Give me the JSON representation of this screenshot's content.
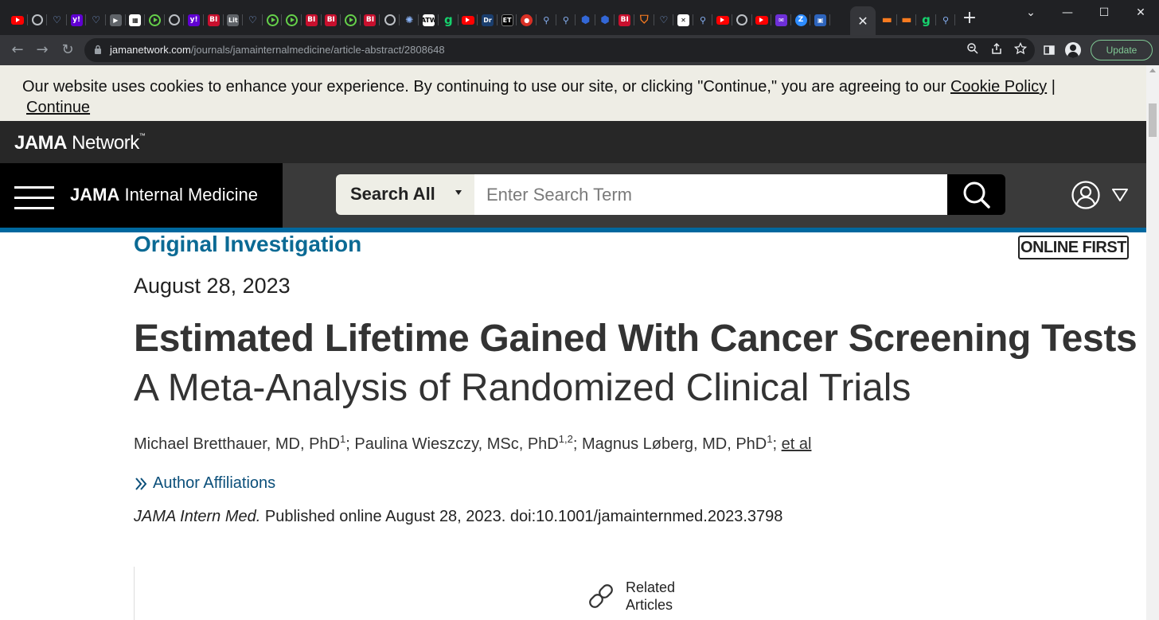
{
  "browser": {
    "active_tab_close": "✕",
    "new_tab": "+",
    "window": {
      "minimize": "⌄",
      "restore": "—",
      "maximize": "☐",
      "close": "✕"
    },
    "url_host": "jamanetwork.com",
    "url_path": "/journals/jamainternalmedicine/article-abstract/2808648",
    "update_label": "Update",
    "tab_favicons": [
      "youtube",
      "globe",
      "heart",
      "yahoo",
      "heart",
      "play-arrow",
      "grid",
      "play",
      "globe",
      "yahoo",
      "business-insider",
      "lit",
      "heart",
      "play",
      "play",
      "business-insider",
      "business-insider",
      "play",
      "business-insider",
      "globe",
      "burst",
      "fortune",
      "gizmodo",
      "youtube",
      "dr",
      "et",
      "mic",
      "search",
      "search",
      "hex",
      "hex",
      "business-insider",
      "shield",
      "heart",
      "academic",
      "search",
      "youtube",
      "globe",
      "youtube",
      "mail",
      "zoom",
      "portrait"
    ],
    "trailing_favicons": [
      "bookmark",
      "bookmark",
      "gizmodo",
      "search"
    ]
  },
  "cookie_banner": {
    "text": "Our website uses cookies to enhance your experience. By continuing to use our site, or clicking \"Continue,\" you are agreeing to our",
    "policy_link": "Cookie Policy",
    "separator": "|",
    "continue_link": "Continue"
  },
  "network_bar": {
    "logo_bold": "JAMA",
    "logo_rest": " Network",
    "logo_tm": "™"
  },
  "journal_bar": {
    "journal_bold": "JAMA",
    "journal_rest": " Internal Medicine",
    "search_scope": "Search All",
    "search_placeholder": "Enter Search Term"
  },
  "article": {
    "type": "Original Investigation",
    "badge": "ONLINE FIRST",
    "date": "August 28, 2023",
    "title": "Estimated Lifetime Gained With Cancer Screening Tests",
    "subtitle": "A Meta-Analysis of Randomized Clinical Trials",
    "authors": [
      {
        "name": "Michael Bretthauer, MD, PhD",
        "sup": "1",
        "sep": "; "
      },
      {
        "name": "Paulina Wieszczy, MSc, PhD",
        "sup": "1,2",
        "sep": "; "
      },
      {
        "name": "Magnus Løberg, MD, PhD",
        "sup": "1",
        "sep": "; "
      }
    ],
    "et_al": "et al",
    "affiliations_label": "Author Affiliations",
    "citation_journal": "JAMA Intern Med.",
    "citation_rest": " Published online August 28, 2023. doi:10.1001/jamainternmed.2023.3798",
    "related_label": "Related Articles"
  },
  "colors": {
    "teal": "#0b6a94",
    "accent_line": "#00689f",
    "cookie_bg": "#eeede5",
    "chrome_dark": "#202124"
  }
}
